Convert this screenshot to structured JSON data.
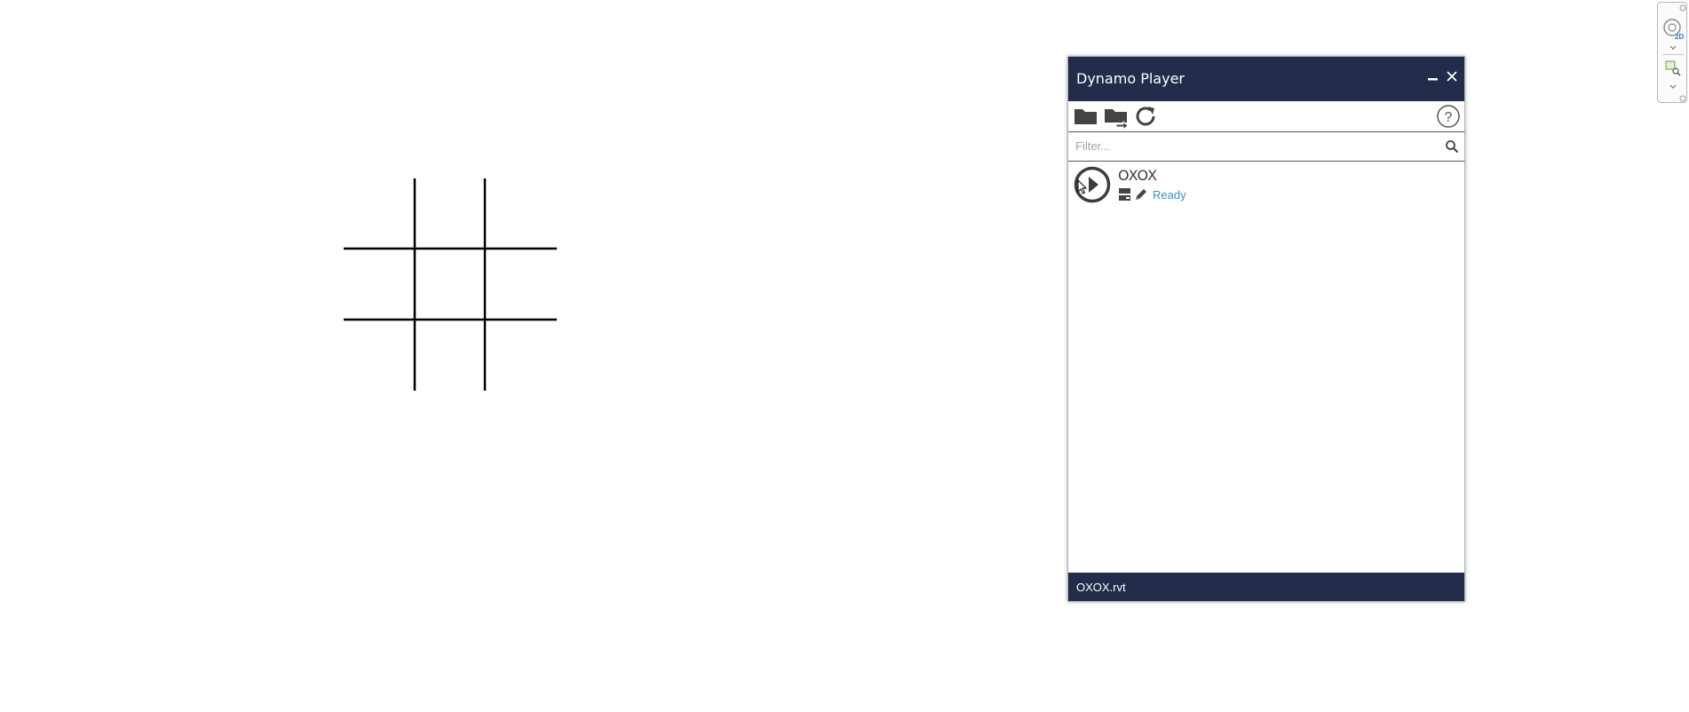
{
  "board": {
    "game": "tic-tac-toe",
    "rows": 3,
    "cols": 3,
    "cells": [
      "",
      "",
      "",
      "",
      "",
      "",
      "",
      "",
      ""
    ]
  },
  "panel": {
    "title": "Dynamo Player",
    "toolbar": {
      "open_folder_icon": "folder-icon",
      "browse_icon": "folder-arrow-icon",
      "refresh_icon": "refresh-icon",
      "help_label": "?"
    },
    "filter": {
      "placeholder": "Filter...",
      "value": ""
    },
    "graphs": [
      {
        "name": "OXOX",
        "status": "Ready"
      }
    ],
    "footer": {
      "filename": "OXOX.rvt"
    }
  },
  "nav_widget": {
    "mode_label": "2D"
  },
  "colors": {
    "panel_header": "#232c4b",
    "status_blue": "#3f8ec8",
    "icon_dark": "#444444"
  }
}
